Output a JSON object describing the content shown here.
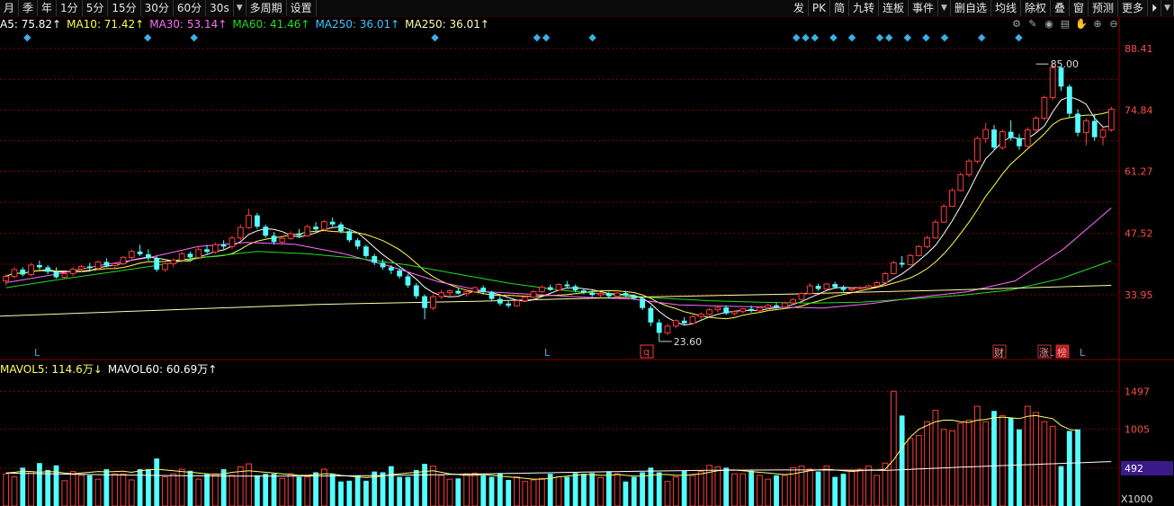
{
  "toolbar": {
    "left": [
      "月",
      "季",
      "年",
      "1分",
      "5分",
      "15分",
      "30分",
      "60分",
      "30s",
      "▼",
      "多周期",
      "设置"
    ],
    "right": [
      "发",
      "PK",
      "简",
      "九转",
      "连板",
      "事件",
      "▼",
      "删自选",
      "均线",
      "除权",
      "叠",
      "窗",
      "预测",
      "更多",
      "⏵",
      "▼"
    ]
  },
  "ma_legend": [
    {
      "text": "A5: 75.82↑",
      "color": "#ffffff"
    },
    {
      "text": "MA10: 71.42↑",
      "color": "#ffff4a"
    },
    {
      "text": "MA30: 53.14↑",
      "color": "#ff6cff"
    },
    {
      "text": "MA60: 41.46↑",
      "color": "#22dd22"
    },
    {
      "text": "MA250: 36.01↑",
      "color": "#3ac8ff"
    },
    {
      "text": "MA250: 36.01↑",
      "color": "#ffffaa"
    }
  ],
  "tools": [
    "gear-icon",
    "pen-icon",
    "eye-icon",
    "trash-icon",
    "hand-icon",
    "zoom-in-icon",
    "zoom-out-icon"
  ],
  "tool_glyphs": [
    "⚙",
    "✎",
    "◉",
    "▤",
    "✋",
    "⊕",
    "⊖"
  ],
  "price_axis": [
    "88.41",
    "74.84",
    "61.27",
    "47.52",
    "33.95"
  ],
  "volume_axis": [
    "1497",
    "1005",
    "492",
    "X1000"
  ],
  "volume_current": "492",
  "annotations": {
    "high_label": "85.00",
    "low_label": "23.60",
    "q_badge": "q",
    "bottom_marks": [
      "L",
      "L",
      "L",
      "L"
    ],
    "right_tags": [
      "财",
      "涨",
      "榜"
    ]
  },
  "vol_legend": [
    {
      "text": "MAVOL5: 114.6万↓",
      "color": "#ffff66"
    },
    {
      "text": "MAVOL60: 60.69万↑",
      "color": "#ffffff"
    }
  ],
  "colors": {
    "up": "#ff3c3c",
    "down": "#54ffff",
    "grid": "#8a0000",
    "axis_text": "#ff4b4b",
    "ma5": "#ffffff",
    "ma10": "#ffff4a",
    "ma30": "#ff6cff",
    "ma60": "#22dd22",
    "ma250": "#ffffaa"
  },
  "chart_data": {
    "type": "candlestick",
    "ylim": [
      20,
      92
    ],
    "yticks": [
      88.41,
      74.84,
      61.27,
      47.52,
      33.95
    ],
    "candles": [
      [
        37,
        38.5,
        36,
        38
      ],
      [
        38,
        40,
        37.5,
        39.5
      ],
      [
        39.5,
        40,
        38,
        38.4
      ],
      [
        38.4,
        41,
        38,
        40.5
      ],
      [
        40.5,
        41.5,
        39.5,
        40
      ],
      [
        40,
        40.5,
        38.5,
        39
      ],
      [
        39,
        40,
        37.5,
        37.8
      ],
      [
        37.8,
        39,
        37.5,
        38.6
      ],
      [
        38.6,
        40,
        38,
        39.6
      ],
      [
        39.6,
        40.5,
        39,
        40.2
      ],
      [
        40.2,
        41,
        39.5,
        39.8
      ],
      [
        39.8,
        41.5,
        39.5,
        41.2
      ],
      [
        41.2,
        42,
        40,
        40.4
      ],
      [
        40.4,
        41,
        39.5,
        40.8
      ],
      [
        40.8,
        42.5,
        40.5,
        42.2
      ],
      [
        42.2,
        44,
        41.5,
        43.5
      ],
      [
        43.5,
        45,
        42.5,
        42.9
      ],
      [
        42.9,
        44,
        41.5,
        42
      ],
      [
        42,
        42.5,
        39,
        39.5
      ],
      [
        39.5,
        41,
        39,
        40.8
      ],
      [
        40.8,
        42,
        40,
        41.6
      ],
      [
        41.6,
        43.5,
        41,
        43
      ],
      [
        43,
        43.5,
        41.8,
        42.2
      ],
      [
        42.2,
        44.5,
        42,
        44
      ],
      [
        44,
        45,
        43,
        43.4
      ],
      [
        43.4,
        45.5,
        43,
        45
      ],
      [
        45,
        46,
        44,
        44.6
      ],
      [
        44.6,
        47,
        44,
        46.5
      ],
      [
        46.5,
        49.5,
        46,
        48.8
      ],
      [
        48.8,
        53,
        48.5,
        51.5
      ],
      [
        51.5,
        52,
        48.5,
        49
      ],
      [
        49,
        49.5,
        46.5,
        47
      ],
      [
        47,
        47.8,
        45,
        45.6
      ],
      [
        45.6,
        47,
        45,
        46.4
      ],
      [
        46.4,
        48,
        46,
        47.4
      ],
      [
        47.4,
        48.5,
        46.5,
        47
      ],
      [
        47,
        49.5,
        46.8,
        49
      ],
      [
        49,
        50,
        48,
        48.4
      ],
      [
        48.4,
        50.5,
        48,
        50.1
      ],
      [
        50.1,
        51,
        49,
        49.5
      ],
      [
        49.5,
        50,
        47.5,
        48
      ],
      [
        48,
        48.5,
        45.5,
        46
      ],
      [
        46,
        46.5,
        44,
        44.6
      ],
      [
        44.6,
        45,
        42,
        42.5
      ],
      [
        42.5,
        43,
        40.5,
        41
      ],
      [
        41,
        41.8,
        39.5,
        40
      ],
      [
        40,
        40.5,
        38.5,
        39.3
      ],
      [
        39.3,
        39.8,
        37.5,
        38
      ],
      [
        38,
        38.5,
        35.5,
        36
      ],
      [
        36,
        36.5,
        33,
        33.6
      ],
      [
        33.6,
        34,
        28.5,
        31
      ],
      [
        31,
        34,
        30.5,
        33.5
      ],
      [
        33.5,
        35,
        33,
        34.4
      ],
      [
        34.4,
        35.2,
        33.5,
        34.8
      ],
      [
        34.8,
        35.5,
        34,
        34.2
      ],
      [
        34.2,
        35,
        33.5,
        34.6
      ],
      [
        34.6,
        35.8,
        34.3,
        35.5
      ],
      [
        35.5,
        36,
        34,
        34.5
      ],
      [
        34.5,
        34.8,
        32.5,
        33
      ],
      [
        33,
        33.5,
        31.5,
        32
      ],
      [
        32,
        32.5,
        31,
        31.5
      ],
      [
        31.5,
        33,
        31.3,
        32.6
      ],
      [
        32.6,
        33.8,
        32.3,
        33.4
      ],
      [
        33.4,
        35,
        33,
        34.6
      ],
      [
        34.6,
        36,
        34.3,
        35.6
      ],
      [
        35.6,
        36.2,
        34.8,
        35
      ],
      [
        35,
        36.5,
        34.8,
        36.2
      ],
      [
        36.2,
        37,
        35.5,
        35.8
      ],
      [
        35.8,
        36.2,
        34.5,
        34.9
      ],
      [
        34.9,
        35.3,
        34,
        34.4
      ],
      [
        34.4,
        35,
        33.5,
        33.9
      ],
      [
        33.9,
        34.5,
        33.2,
        34.2
      ],
      [
        34.2,
        34.6,
        33.3,
        33.6
      ],
      [
        33.6,
        34.5,
        33.2,
        34.3
      ],
      [
        34.3,
        34.8,
        33.5,
        33.8
      ],
      [
        33.8,
        34,
        32.8,
        33.1
      ],
      [
        33.1,
        33.5,
        30.5,
        31
      ],
      [
        31,
        31.5,
        27,
        27.8
      ],
      [
        27.8,
        28.5,
        23.6,
        25.5
      ],
      [
        25.5,
        27.5,
        25,
        27
      ],
      [
        27,
        28.5,
        26.5,
        28.2
      ],
      [
        28.2,
        29,
        27.3,
        27.6
      ],
      [
        27.6,
        29.5,
        27.4,
        29.1
      ],
      [
        29.1,
        30,
        28.5,
        29.6
      ],
      [
        29.6,
        31,
        29.3,
        30.6
      ],
      [
        30.6,
        31.5,
        30,
        31.1
      ],
      [
        31.1,
        31.6,
        29.5,
        29.8
      ],
      [
        29.8,
        30.5,
        29.3,
        30.2
      ],
      [
        30.2,
        31,
        29.8,
        30.8
      ],
      [
        30.8,
        31.5,
        30,
        30.4
      ],
      [
        30.4,
        31.4,
        30.1,
        31.1
      ],
      [
        31.1,
        32,
        30.7,
        31.6
      ],
      [
        31.6,
        32.2,
        30.9,
        31.2
      ],
      [
        31.2,
        32.4,
        31,
        32.1
      ],
      [
        32.1,
        33.2,
        31.8,
        32.9
      ],
      [
        32.9,
        34.5,
        32.6,
        34.2
      ],
      [
        34.2,
        36.5,
        34,
        35.9
      ],
      [
        35.9,
        36.4,
        34.8,
        35.2
      ],
      [
        35.2,
        36.6,
        35,
        36.3
      ],
      [
        36.3,
        36.8,
        35.2,
        35.6
      ],
      [
        35.6,
        36,
        34.6,
        35
      ],
      [
        35,
        35.6,
        34.4,
        35.3
      ],
      [
        35.3,
        35.8,
        34.6,
        35.5
      ],
      [
        35.5,
        36.2,
        35,
        35.9
      ],
      [
        35.9,
        37,
        35.7,
        36.6
      ],
      [
        36.6,
        39,
        36.5,
        38.6
      ],
      [
        38.6,
        41.5,
        38.4,
        41
      ],
      [
        41,
        42.5,
        40,
        40.6
      ],
      [
        40.6,
        43,
        40.4,
        42.6
      ],
      [
        42.6,
        45,
        42.4,
        44.6
      ],
      [
        44.6,
        47,
        44.2,
        46.5
      ],
      [
        46.5,
        50.5,
        46.3,
        50
      ],
      [
        50,
        54,
        49.8,
        53.5
      ],
      [
        53.5,
        57.5,
        53.3,
        57
      ],
      [
        57,
        61,
        56.8,
        60.5
      ],
      [
        60.5,
        64,
        60,
        63.5
      ],
      [
        63.5,
        69,
        63,
        68.5
      ],
      [
        68.5,
        72,
        67.5,
        70.5
      ],
      [
        70.5,
        71.5,
        66,
        66.5
      ],
      [
        66.5,
        70.5,
        66,
        70
      ],
      [
        70,
        72.5,
        68,
        68.6
      ],
      [
        68.6,
        69.5,
        66,
        66.8
      ],
      [
        66.8,
        71,
        66.5,
        70.4
      ],
      [
        70.4,
        73.5,
        70,
        73
      ],
      [
        73,
        78,
        72.5,
        77.6
      ],
      [
        77.6,
        85,
        77,
        84.2
      ],
      [
        84.2,
        84.5,
        79,
        80
      ],
      [
        80,
        80.5,
        73,
        74
      ],
      [
        74,
        75,
        69,
        69.8
      ],
      [
        69.8,
        73,
        67,
        72.4
      ],
      [
        72.4,
        74,
        68,
        68.8
      ],
      [
        68.8,
        71,
        67,
        70.4
      ],
      [
        70.4,
        75.5,
        70,
        75
      ]
    ],
    "ma_series": [
      {
        "name": "MA5",
        "color": "#ffffff"
      },
      {
        "name": "MA10",
        "color": "#ffff4a"
      },
      {
        "name": "MA30",
        "color": "#ff6cff"
      },
      {
        "name": "MA60",
        "color": "#22dd22"
      },
      {
        "name": "MA250",
        "color": "#ffffaa"
      }
    ],
    "ma250_values": [
      29.2,
      30.5,
      31.8,
      32.5,
      33.4,
      34.1,
      35.0,
      36.01
    ],
    "ma30_values": [
      36.6,
      38.4,
      40.5,
      42.2,
      44.6,
      45.5,
      45.1,
      43.1,
      40.2,
      36.8,
      34.6,
      34.0,
      33.4,
      33.0,
      31.7,
      31.4,
      31.2,
      31.0,
      32.0,
      33.4,
      34.6,
      37.0,
      44.0,
      53.14
    ],
    "ma60_values": [
      35.5,
      37.2,
      38.8,
      40.4,
      42.3,
      43.5,
      43.0,
      42.0,
      40.5,
      38.5,
      36.5,
      35.0,
      34.0,
      33.2,
      32.6,
      32.3,
      32.1,
      32.3,
      33.0,
      33.8,
      35.0,
      37.5,
      41.46
    ],
    "volume": {
      "ylim": [
        0,
        1700
      ],
      "mavol5_label": "MAVOL5",
      "values": [
        420,
        380,
        500,
        450,
        560,
        470,
        530,
        330,
        450,
        400,
        400,
        350,
        480,
        420,
        420,
        340,
        480,
        480,
        620,
        380,
        420,
        480,
        460,
        350,
        420,
        420,
        480,
        400,
        510,
        550,
        400,
        420,
        420,
        360,
        420,
        380,
        380,
        440,
        480,
        420,
        320,
        330,
        400,
        330,
        450,
        440,
        520,
        380,
        380,
        470,
        550,
        520,
        400,
        350,
        360,
        420,
        430,
        400,
        380,
        430,
        340,
        380,
        320,
        340,
        360,
        420,
        380,
        380,
        430,
        420,
        430,
        370,
        450,
        420,
        320,
        380,
        440,
        500,
        440,
        320,
        380,
        460,
        400,
        450,
        530,
        510,
        500,
        420,
        420,
        460,
        400,
        350,
        400,
        400,
        500,
        520,
        480,
        450,
        520,
        380,
        420,
        460,
        480,
        520,
        400,
        560,
        1497,
        1180,
        880,
        920,
        1100,
        1250,
        1000,
        980,
        1080,
        1120,
        1300,
        1100,
        1240,
        1180,
        1150,
        1000,
        1300,
        1220,
        1100,
        1040,
        520,
        980,
        1000
      ],
      "mavol5": [
        430,
        440,
        455,
        450,
        440,
        450,
        445,
        430,
        420,
        430,
        440,
        450,
        445,
        450,
        455,
        440,
        460,
        470,
        480,
        470,
        460,
        450,
        440,
        430,
        420,
        410,
        420,
        440,
        450,
        460,
        450,
        440,
        430,
        420,
        410,
        400,
        400,
        410,
        420,
        420,
        400,
        390,
        380,
        370,
        380,
        390,
        410,
        420,
        430,
        440,
        450,
        460,
        440,
        420,
        410,
        400,
        400,
        410,
        400,
        390,
        380,
        370,
        360,
        350,
        350,
        360,
        380,
        390,
        400,
        410,
        410,
        400,
        400,
        410,
        400,
        390,
        390,
        400,
        410,
        410,
        400,
        400,
        410,
        420,
        440,
        460,
        470,
        470,
        460,
        450,
        440,
        430,
        420,
        410,
        420,
        440,
        460,
        470,
        480,
        470,
        460,
        450,
        460,
        470,
        470,
        480,
        600,
        760,
        900,
        1000,
        1050,
        1100,
        1120,
        1120,
        1100,
        1090,
        1120,
        1130,
        1150,
        1160,
        1150,
        1140,
        1170,
        1180,
        1160,
        1140,
        1050,
        1000,
        980
      ]
    }
  }
}
